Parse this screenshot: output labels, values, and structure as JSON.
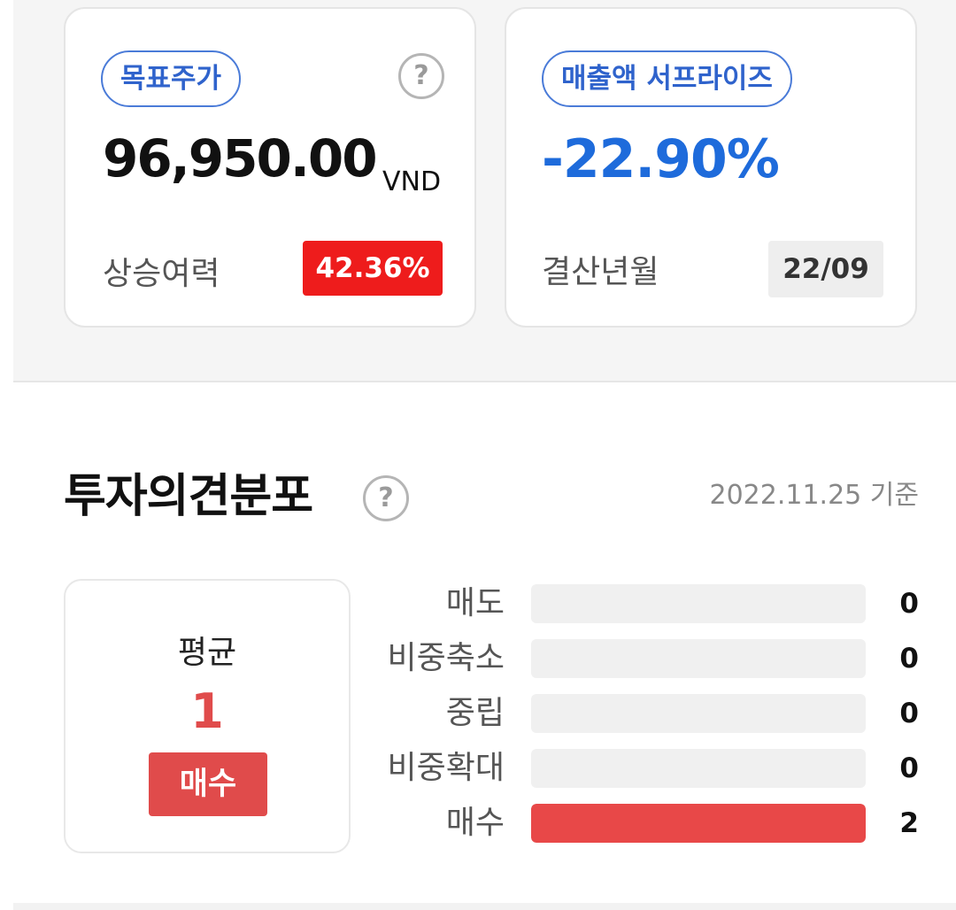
{
  "target_price": {
    "pill_label": "목표주가",
    "help_symbol": "?",
    "value": "96,950.00",
    "currency": "VND",
    "upside_label": "상승여력",
    "upside_value": "42.36%"
  },
  "sales_surprise": {
    "pill_label": "매출액 서프라이즈",
    "value": "-22.90%",
    "period_label": "결산년월",
    "period_value": "22/09"
  },
  "opinion": {
    "title": "투자의견분포",
    "help_symbol": "?",
    "date": "2022.11.25 기준",
    "average_label": "평균",
    "average_score": "1",
    "average_rating": "매수",
    "max_count": 2,
    "rows": [
      {
        "label": "매도",
        "count": "0",
        "value": 0
      },
      {
        "label": "비중축소",
        "count": "0",
        "value": 0
      },
      {
        "label": "중립",
        "count": "0",
        "value": 0
      },
      {
        "label": "비중확대",
        "count": "0",
        "value": 0
      },
      {
        "label": "매수",
        "count": "2",
        "value": 2
      }
    ]
  },
  "colors": {
    "accent_blue": "#1e6bdb",
    "pill_border": "#4a7bd8",
    "upside_red": "#ee1c1c",
    "buy_red": "#e04b4b",
    "bar_red": "#e84848"
  }
}
